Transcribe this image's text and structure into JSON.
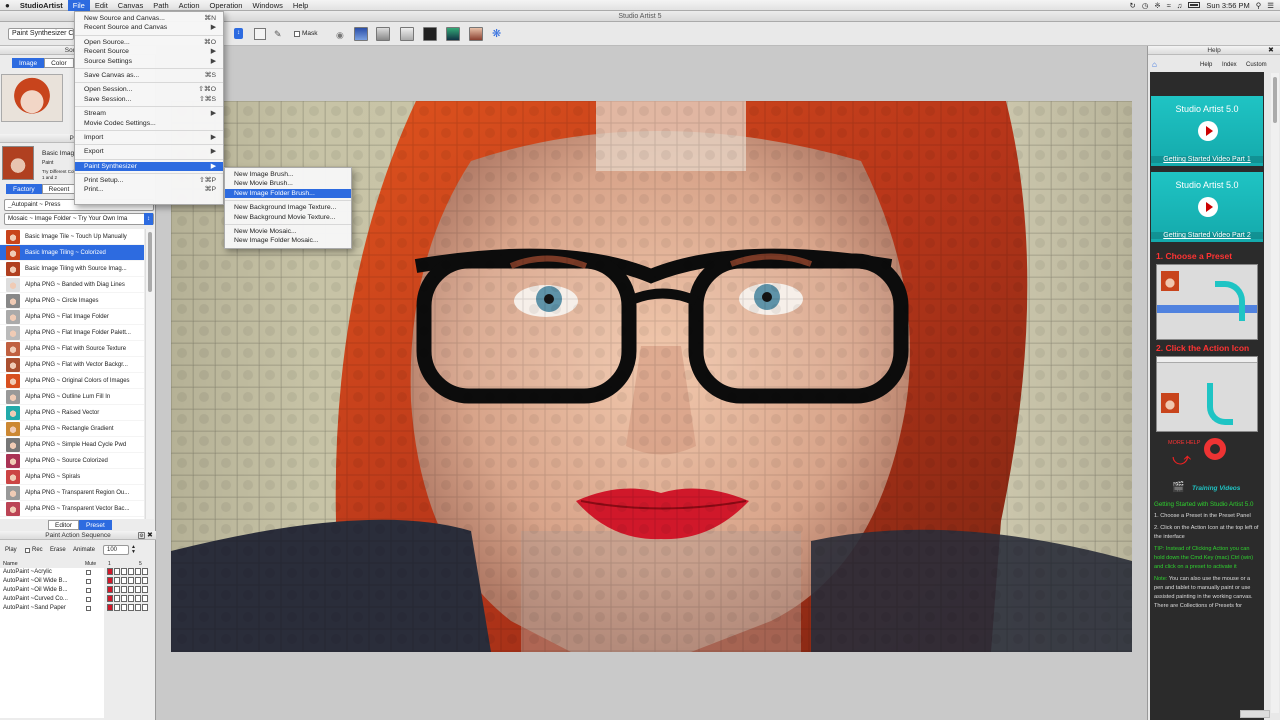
{
  "menubar": {
    "app": "StudioArtist",
    "items": [
      "File",
      "Edit",
      "Canvas",
      "Path",
      "Action",
      "Operation",
      "Windows",
      "Help"
    ],
    "active": "File",
    "clock": "Sun 3:56 PM"
  },
  "window": {
    "title": "Studio Artist 5"
  },
  "toolbar": {
    "synth_select": "Paint Synthesizer Cl",
    "mask_label": "Mask"
  },
  "source_area": {
    "title": "Source A",
    "tab_image": "Image",
    "tab_color": "Color"
  },
  "preset_panel": {
    "title": "Prese",
    "current_name": "Basic Imag",
    "current_sub1": "Paint",
    "current_sub2": "Try Different Col",
    "current_sub3": "1 and 2",
    "tab_factory": "Factory",
    "tab_recent": "Recent",
    "category": "_Autopaint ~ Press",
    "subcategory": "Mosaic ~ Image Folder ~ Try Your Own Ima",
    "items": [
      "Basic Image Tile ~ Touch Up Manually",
      "Basic Image Tiling ~ Colorized",
      "Basic Image Tiling with Source Imag...",
      "Alpha PNG ~ Banded with Diag Lines",
      "Alpha PNG ~ Circle Images",
      "Alpha PNG ~ Flat Image Folder",
      "Alpha PNG ~ Flat Image Folder Palett...",
      "Alpha PNG ~ Flat with Source Texture",
      "Alpha PNG ~ Flat with Vector Backgr...",
      "Alpha PNG ~ Original Colors of Images",
      "Alpha PNG ~ Outline Lum Fill In",
      "Alpha PNG ~ Raised Vector",
      "Alpha PNG ~ Rectangle Gradient",
      "Alpha PNG ~ Simple Head Cycle Pwd",
      "Alpha PNG ~ Source Colorized",
      "Alpha PNG ~ Spirals",
      "Alpha PNG ~ Transparent Region Ou...",
      "Alpha PNG ~ Transparent Vector Bac..."
    ],
    "selected_index": 1,
    "tab_editor": "Editor",
    "tab_preset": "Preset"
  },
  "pas": {
    "title": "Paint Action Sequence",
    "play": "Play",
    "rec": "Rec",
    "erase": "Erase",
    "animate": "Animate",
    "animate_value": "100",
    "col_name": "Name",
    "col_mute": "Mute",
    "col_1": "1",
    "col_5": "5",
    "rows": [
      "AutoPaint ~Acrylic",
      "AutoPaint ~Oil Wide B...",
      "AutoPaint ~Oil Wide B...",
      "AutoPaint ~Curved Co...",
      "AutoPaint ~Sand Paper"
    ]
  },
  "file_menu": {
    "items": [
      {
        "label": "New Source and Canvas...",
        "shortcut": "⌘N"
      },
      {
        "label": "Recent Source and Canvas",
        "shortcut": "▶"
      },
      {
        "sep": true
      },
      {
        "label": "Open Source...",
        "shortcut": "⌘O"
      },
      {
        "label": "Recent Source",
        "shortcut": "▶"
      },
      {
        "label": "Source Settings",
        "shortcut": "▶"
      },
      {
        "sep": true
      },
      {
        "label": "Save Canvas as...",
        "shortcut": "⌘S"
      },
      {
        "sep": true
      },
      {
        "label": "Open Session...",
        "shortcut": "⇧⌘O"
      },
      {
        "label": "Save Session...",
        "shortcut": "⇧⌘S"
      },
      {
        "sep": true
      },
      {
        "label": "Stream",
        "shortcut": "▶"
      },
      {
        "label": "Movie Codec Settings...",
        "shortcut": ""
      },
      {
        "sep": true
      },
      {
        "label": "Import",
        "shortcut": "▶"
      },
      {
        "sep": true
      },
      {
        "label": "Export",
        "shortcut": "▶"
      },
      {
        "sep": true
      },
      {
        "label": "Paint Synthesizer",
        "shortcut": "▶",
        "hl": true
      },
      {
        "sep": true
      },
      {
        "label": "Print Setup...",
        "shortcut": "⇧⌘P"
      },
      {
        "label": "Print...",
        "shortcut": "⌘P"
      }
    ]
  },
  "submenu": {
    "items": [
      {
        "label": "New Image Brush..."
      },
      {
        "label": "New Movie Brush..."
      },
      {
        "label": "New Image Folder Brush...",
        "hl": true
      },
      {
        "sep": true
      },
      {
        "label": "New Background Image Texture..."
      },
      {
        "label": "New Background Movie Texture..."
      },
      {
        "sep": true
      },
      {
        "label": "New Movie Mosaic..."
      },
      {
        "label": "New Image Folder Mosaic..."
      }
    ]
  },
  "help": {
    "title": "Help",
    "nav_help": "Help",
    "nav_index": "Index",
    "nav_custom": "Custom",
    "video1_title": "Studio Artist 5.0",
    "video1_link": "Getting Started Video Part 1",
    "video2_title": "Studio Artist 5.0",
    "video2_link": "Getting Started Video Part 2",
    "step1": "1. Choose a Preset",
    "step2": "2. Click the Action Icon",
    "more_help": "MORE HELP",
    "training": "Training Videos",
    "text_heading": "Getting Started with Studio Artist 5.0",
    "text_p1": "1. Choose a Preset in the Preset Panel",
    "text_p2": "2. Click on the Action Icon at the top left of the interface",
    "tip_label": "TIP:",
    "tip_text": "Instead of Clicking Action you can hold down the Cmd Key (mac) Ctrl (win) and click on a preset to activate it",
    "note_label": "Note:",
    "note_text": "You can also use the mouse or a pen and tablet to manually paint or use assisted painting in the working canvas. There are Collections of Presets for"
  },
  "colors": {
    "accent": "#2d6be0",
    "teal": "#1fc4c4",
    "hair": "#c8441c",
    "lips": "#d0182a"
  }
}
